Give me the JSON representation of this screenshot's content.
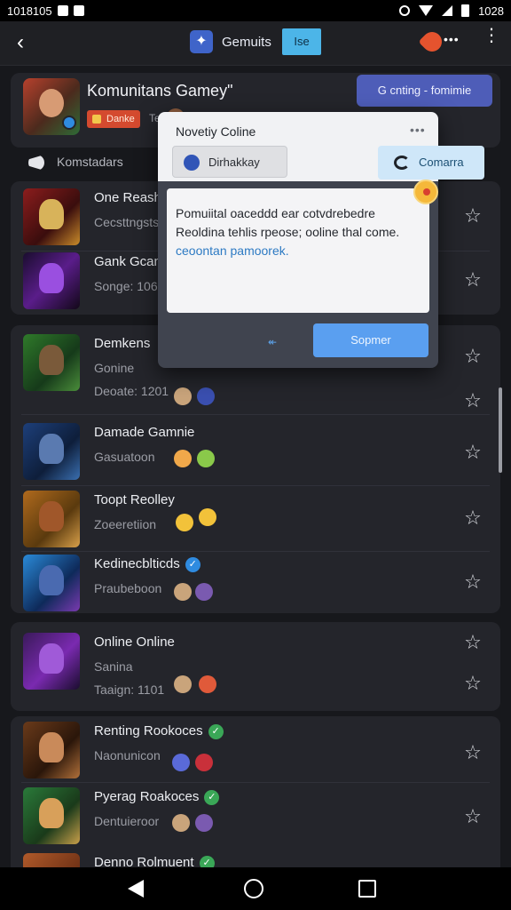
{
  "status_bar": {
    "time": "1018105",
    "clock": "1028"
  },
  "app_bar": {
    "title": "Gemuits",
    "badge": "Ise"
  },
  "header": {
    "title": "Komunitans Gamey\"",
    "tag": "Danke",
    "small": "Te",
    "action_button": "G cnting - fomimie"
  },
  "tab": {
    "label": "Komstadars"
  },
  "list_group_1": [
    {
      "name": "One Reasht",
      "sub": "Cecsttngsts"
    },
    {
      "name": "Gank Gcant",
      "sub": "Songe: 1062"
    }
  ],
  "list_group_2": [
    {
      "name": "Demkens",
      "sub": "Gonine",
      "sub2": "Deoate: 1201"
    },
    {
      "name": "Damade Gamnie",
      "sub": "Gasuatoon"
    },
    {
      "name": "Toopt Reolley",
      "sub": "Zoeeretiion"
    },
    {
      "name": "Kedinecblticds",
      "sub": "Praubeboon"
    }
  ],
  "list_group_3": [
    {
      "name": "Online Online",
      "sub": "Sanina",
      "sub2": "Taaign: 1101"
    }
  ],
  "list_group_4": [
    {
      "name": "Renting Rookoces",
      "sub": "Naonunicon"
    },
    {
      "name": "Pyerag Roakoces",
      "sub": "Dentuieroor"
    },
    {
      "name": "Denno Rolmuent"
    }
  ],
  "dialog": {
    "title": "Novetiy Coline",
    "more": "•••",
    "tab1": "Dirhakkay",
    "tab2": "Comarra",
    "body_text": "Pomuiital oaceddd ear cotvdrebedre Reoldina tehlis rpeose; ooline thal come.",
    "body_link": "ceoontan pamoorek.",
    "arrow": "↞",
    "submit": "Sopmer"
  },
  "colors": {
    "accent": "#4e5db8",
    "submit": "#5a9ff0",
    "verified": "#3aa757"
  }
}
